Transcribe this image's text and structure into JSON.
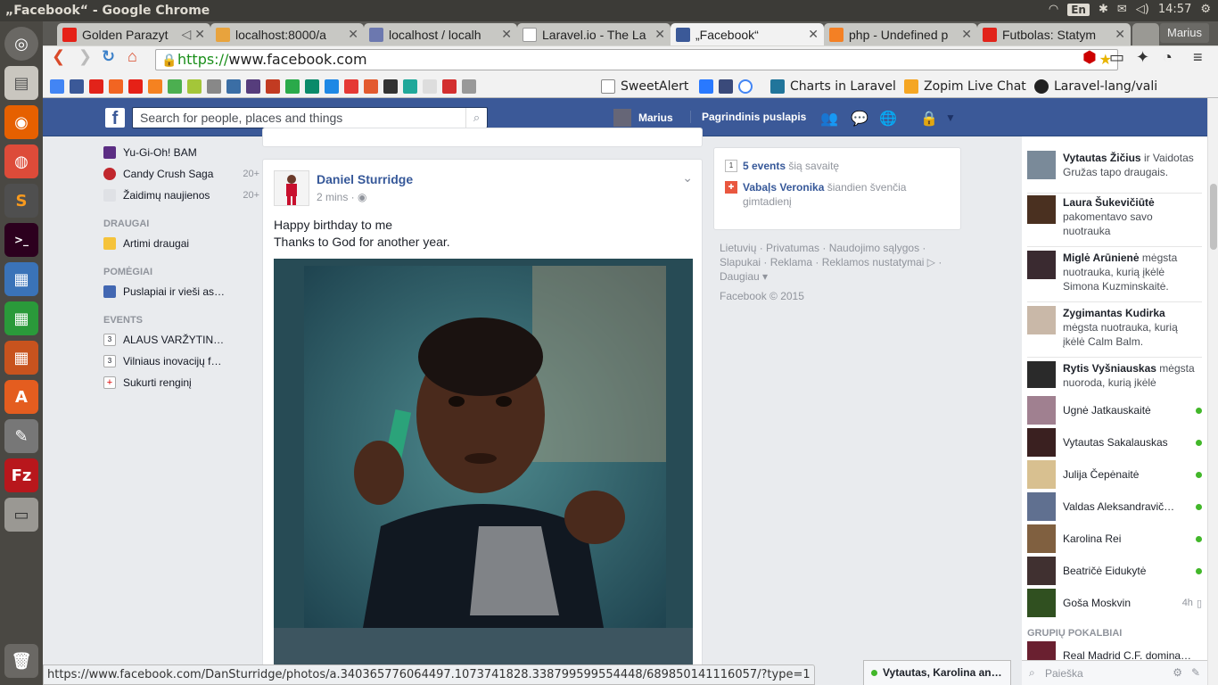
{
  "system": {
    "window_title": "„Facebook“ - Google Chrome",
    "keyboard_layout": "En",
    "clock": "14:57"
  },
  "browser": {
    "tabs": [
      {
        "label": "Golden Parazyt",
        "favicon_color": "#e62117",
        "icon": "youtube-icon"
      },
      {
        "label": "localhost:8000/a",
        "favicon_color": "#e8a33d",
        "icon": "star-icon"
      },
      {
        "label": "localhost / localh",
        "favicon_color": "#6c78af",
        "icon": "phpmyadmin-icon"
      },
      {
        "label": "Laravel.io - The La",
        "favicon_color": "#ffffff",
        "icon": "laravel-io-icon"
      },
      {
        "label": "„Facebook“",
        "favicon_color": "#3b5998",
        "icon": "facebook-icon"
      },
      {
        "label": "php - Undefined p",
        "favicon_color": "#f48024",
        "icon": "stackoverflow-icon"
      },
      {
        "label": "Futbolas: Statym",
        "favicon_color": "#e2231a",
        "icon": "bookmark-icon"
      }
    ],
    "profile_name": "Marius",
    "url_scheme": "https://",
    "url_rest": "www.facebook.com",
    "bookmarks": [
      {
        "label": "SweetAlert",
        "icon": "page-icon"
      },
      {
        "label": "Charts in Laravel",
        "icon": "wordpress-icon"
      },
      {
        "label": "Zopim Live Chat",
        "icon": "zopim-icon"
      },
      {
        "label": "Laravel-lang/vali",
        "icon": "github-icon"
      }
    ],
    "status_url": "https://www.facebook.com/DanSturridge/photos/a.340365776064497.1073741828.338799599554448/689850141116057/?type=1"
  },
  "facebook": {
    "search_placeholder": "Search for people, places and things",
    "user_name": "Marius",
    "home_label": "Pagrindinis puslapis",
    "left_nav": {
      "games": [
        {
          "label": "Yu-Gi-Oh! BAM",
          "count": "",
          "color": "#5b2d83"
        },
        {
          "label": "Candy Crush Saga",
          "count": "20+",
          "color": "#c1272d"
        },
        {
          "label": "Žaidimų naujienos",
          "count": "20+",
          "color": "#8d949e"
        }
      ],
      "friends_heading": "DRAUGAI",
      "friends": [
        {
          "label": "Artimi draugai",
          "color": "#f5c33b"
        }
      ],
      "pages_heading": "POMĖGIAI",
      "pages": [
        {
          "label": "Puslapiai ir vieši as…",
          "color": "#4267b2"
        }
      ],
      "events_heading": "EVENTS",
      "events": [
        {
          "label": "ALAUS VARŽYTIN…",
          "icon_text": "3"
        },
        {
          "label": "Vilniaus inovacijų f…",
          "icon_text": "3"
        },
        {
          "label": "Sukurti renginį",
          "icon_text": "+"
        }
      ]
    },
    "post": {
      "author": "Daniel Sturridge",
      "time": "2 mins ·",
      "text_line1": "Happy birthday to me",
      "text_line2": "Thanks to God for another year."
    },
    "events_box": {
      "count_label": "5 events",
      "count_suffix": "šią savaitę",
      "calendar_day": "1",
      "birthday_name": "Vabaļs Veronika",
      "birthday_text": "šiandien švenčia gimtadienį"
    },
    "footer": {
      "links": "Lietuvių · Privatumas · Naudojimo sąlygos · Slapukai · Reklama · Reklamos nustatymai ▷ · Daugiau ▾",
      "copyright": "Facebook © 2015"
    },
    "ticker": [
      {
        "name": "Vytautas Žičius",
        "text": "ir Vaidotas Gružas tapo draugais.",
        "color": "#7a8a99"
      },
      {
        "name": "Laura Šukevičiūtė",
        "text": "pakomentavo savo nuotrauka",
        "color": "#4a3020"
      },
      {
        "name": "Miglė Arūnienė",
        "text": "mėgsta nuotrauka, kurią įkėlė Simona Kuzminskaitė.",
        "color": "#3a2a30"
      },
      {
        "name": "Zygimantas Kudirka",
        "text": "mėgsta nuotrauka, kurią įkėlė Calm Balm.",
        "color": "#c9b8a8"
      },
      {
        "name": "Rytis Vyšniauskas",
        "text": "mėgsta nuoroda, kurią įkėlė",
        "color": "#2a2a2a"
      }
    ],
    "chat_friends": [
      {
        "name": "Ugnė Jatkauskaitė",
        "status": "online",
        "ago": "",
        "color": "#a08090"
      },
      {
        "name": "Vytautas Sakalauskas",
        "status": "online",
        "ago": "",
        "color": "#3a2020"
      },
      {
        "name": "Julija Čepėnaitė",
        "status": "online",
        "ago": "",
        "color": "#d8c090"
      },
      {
        "name": "Valdas Aleksandravič…",
        "status": "online",
        "ago": "",
        "color": "#607090"
      },
      {
        "name": "Karolina Rei",
        "status": "online",
        "ago": "",
        "color": "#806040"
      },
      {
        "name": "Beatričė Eidukytė",
        "status": "online",
        "ago": "",
        "color": "#403030"
      },
      {
        "name": "Goša Moskvin",
        "status": "mobile",
        "ago": "4h",
        "color": "#305020"
      }
    ],
    "group_chats_heading": "GRUPIŲ POKALBIAI",
    "group_chat": {
      "name": "Real Madrid C.F. domina…",
      "color": "#6a2030"
    },
    "chat_search_placeholder": "Paieška",
    "open_chat_tab": "Vytautas, Karolina an…"
  }
}
